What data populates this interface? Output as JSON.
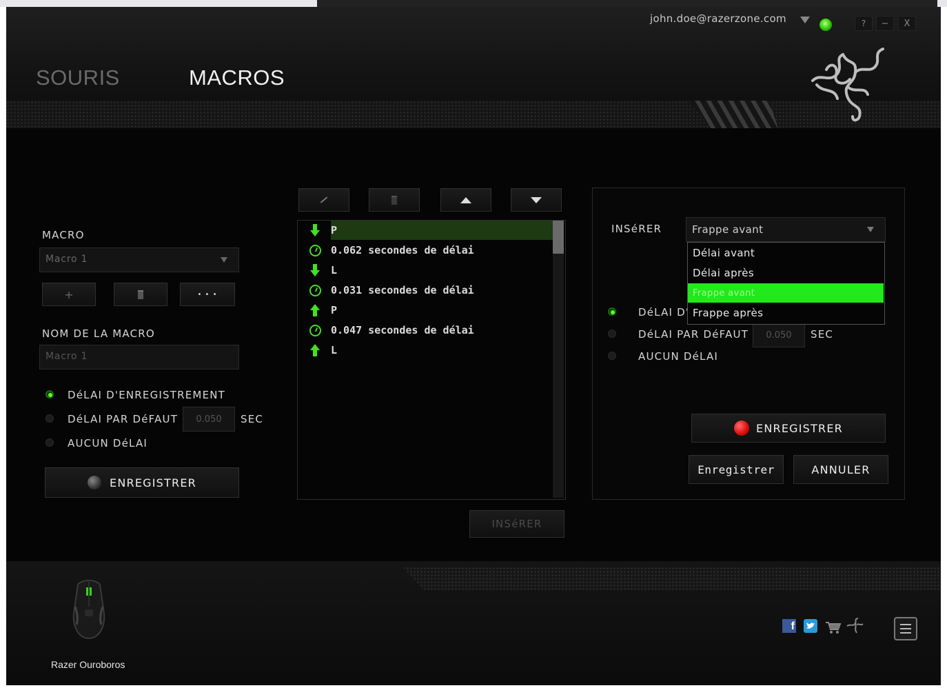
{
  "window": {
    "account_email": "john.doe@razerzone.com",
    "help_label": "?",
    "minimize_label": "−",
    "close_label": "X"
  },
  "nav": {
    "tabs": [
      {
        "label": "SOURIS",
        "active": false
      },
      {
        "label": "MACROS",
        "active": true
      }
    ]
  },
  "left": {
    "macro_label": "MACRO",
    "macro_select_value": "Macro 1",
    "add_label": "+",
    "delete_icon": "trash-icon",
    "more_label": "• • •",
    "name_label": "NOM DE LA MACRO",
    "name_value": "Macro 1",
    "delay_options": [
      {
        "label": "DéLAI D'ENREGISTREMENT",
        "selected": true
      },
      {
        "label": "DéLAI PAR DéFAUT",
        "selected": false
      },
      {
        "label": "AUCUN DéLAI",
        "selected": false
      }
    ],
    "default_delay_value": "0.050",
    "sec_label": "SEC",
    "record_label": "ENREGISTRER"
  },
  "middle": {
    "toolbar_icons": [
      "pencil-icon",
      "trash-icon",
      "arrow-up-icon",
      "arrow-down-icon"
    ],
    "steps": [
      {
        "icon": "key-down-icon",
        "text": "P",
        "selected": true
      },
      {
        "icon": "clock-icon",
        "text": "0.062 secondes de délai",
        "selected": false
      },
      {
        "icon": "key-down-icon",
        "text": "L",
        "selected": false
      },
      {
        "icon": "clock-icon",
        "text": "0.031 secondes de délai",
        "selected": false
      },
      {
        "icon": "key-up-icon",
        "text": "P",
        "selected": false
      },
      {
        "icon": "clock-icon",
        "text": "0.047 secondes de délai",
        "selected": false
      },
      {
        "icon": "key-up-icon",
        "text": "L",
        "selected": false
      }
    ],
    "insert_label": "INSéRER"
  },
  "right": {
    "insert_label": "INSéRER",
    "insert_select_value": "Frappe avant",
    "dropdown_options": [
      {
        "label": "Délai avant",
        "highlighted": false
      },
      {
        "label": "Délai après",
        "highlighted": false
      },
      {
        "label": "Frappe avant",
        "highlighted": true
      },
      {
        "label": "Frappe après",
        "highlighted": false
      }
    ],
    "delay_options": [
      {
        "label": "DéLAI D'ENREGISTREMENT",
        "selected": true
      },
      {
        "label": "DéLAI PAR DéFAUT",
        "selected": false
      },
      {
        "label": "AUCUN DéLAI",
        "selected": false
      }
    ],
    "default_delay_value": "0.050",
    "sec_label": "SEC",
    "record_label": "ENREGISTRER",
    "save_label": "Enregistrer",
    "cancel_label": "ANNULER"
  },
  "footer": {
    "device_name": "Razer Ouroboros",
    "social_icons": [
      "facebook-icon",
      "twitter-icon",
      "cart-icon",
      "razer-icon"
    ],
    "menu_icon": "menu-icon"
  },
  "colors": {
    "accent": "#44d62c",
    "highlight": "#22e81c",
    "record_red": "#e01010"
  }
}
